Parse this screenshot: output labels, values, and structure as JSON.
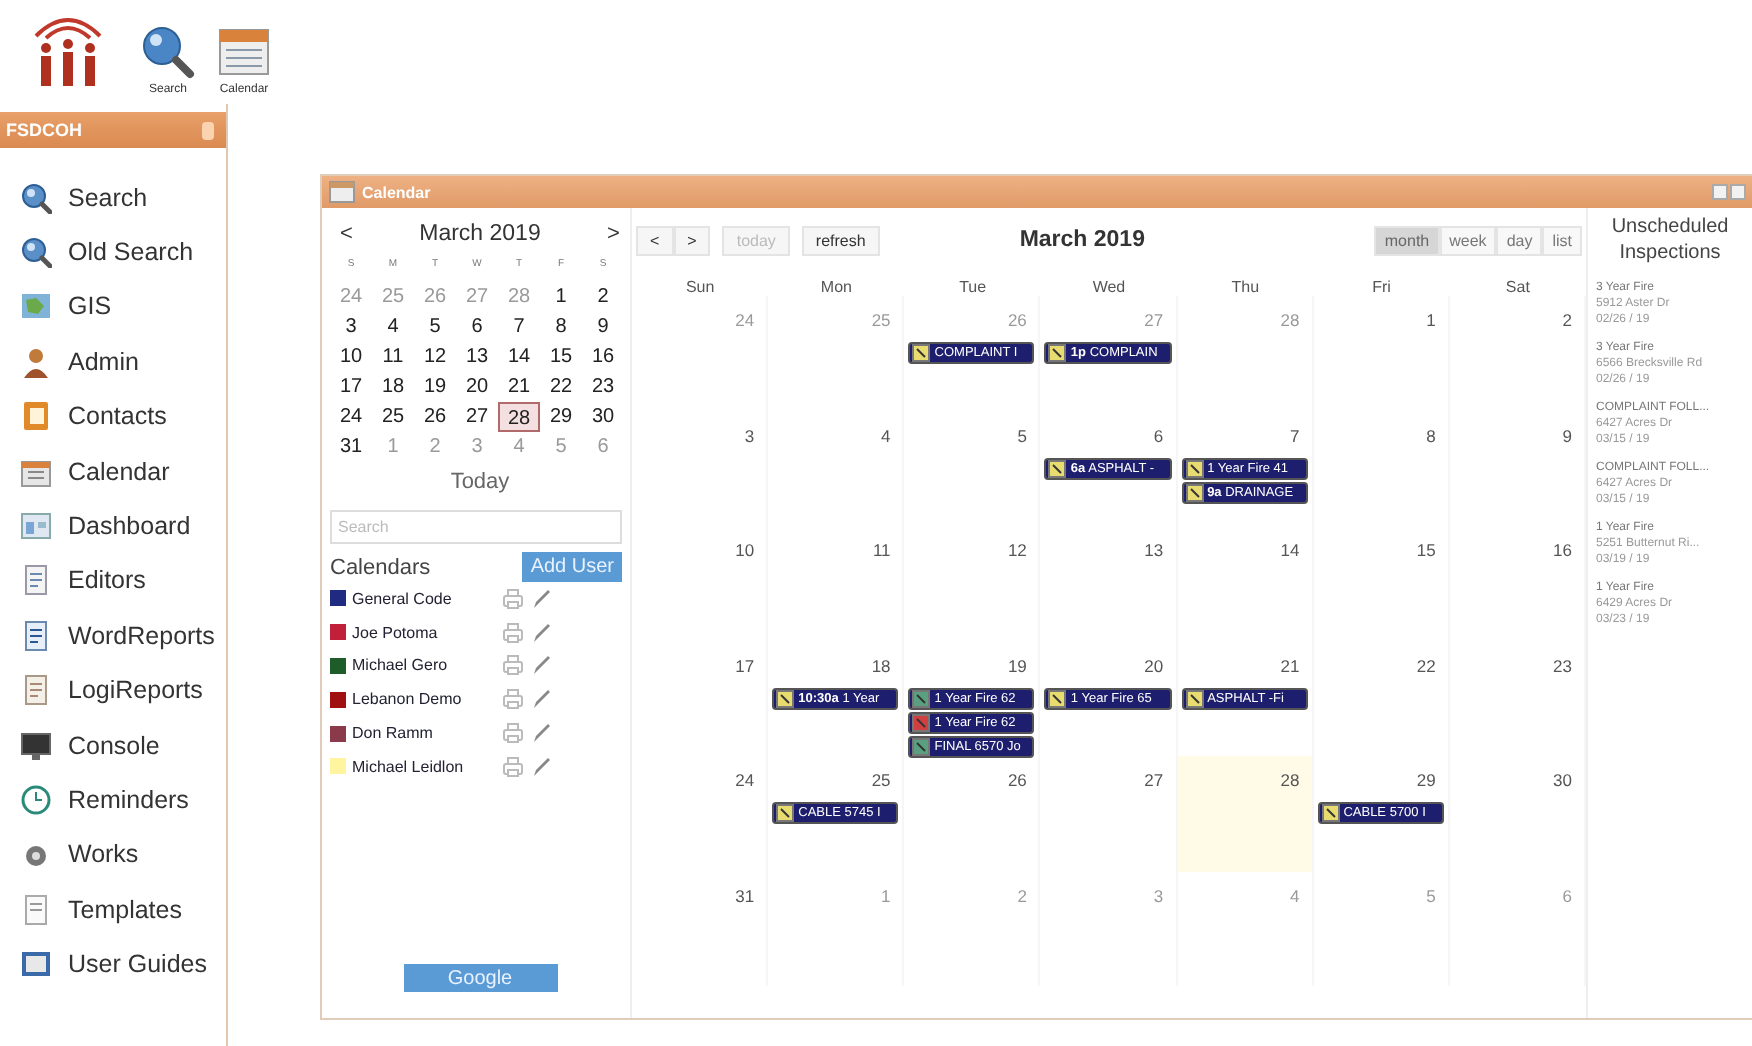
{
  "toolbar": [
    {
      "label": "Search"
    },
    {
      "label": "Calendar"
    }
  ],
  "sidebar": {
    "title": "FSDCOH",
    "items": [
      {
        "label": "Search"
      },
      {
        "label": "Old Search"
      },
      {
        "label": "GIS"
      },
      {
        "label": "Admin"
      },
      {
        "label": "Contacts"
      },
      {
        "label": "Calendar"
      },
      {
        "label": "Dashboard"
      },
      {
        "label": "Editors"
      },
      {
        "label": "WordReports"
      },
      {
        "label": "LogiReports"
      },
      {
        "label": "Console"
      },
      {
        "label": "Reminders"
      },
      {
        "label": "Works"
      },
      {
        "label": "Templates"
      },
      {
        "label": "User Guides"
      }
    ]
  },
  "window": {
    "title": "Calendar"
  },
  "mini_calendar": {
    "prev": "<",
    "title": "March 2019",
    "next": ">",
    "weekdays": [
      "S",
      "M",
      "T",
      "W",
      "T",
      "F",
      "S"
    ],
    "weeks": [
      [
        {
          "day": "24",
          "other_month": true,
          "selected": false
        },
        {
          "day": "25",
          "other_month": true,
          "selected": false
        },
        {
          "day": "26",
          "other_month": true,
          "selected": false
        },
        {
          "day": "27",
          "other_month": true,
          "selected": false
        },
        {
          "day": "28",
          "other_month": true,
          "selected": false
        },
        {
          "day": "1",
          "other_month": false,
          "selected": false
        },
        {
          "day": "2",
          "other_month": false,
          "selected": false
        }
      ],
      [
        {
          "day": "3",
          "other_month": false,
          "selected": false
        },
        {
          "day": "4",
          "other_month": false,
          "selected": false
        },
        {
          "day": "5",
          "other_month": false,
          "selected": false
        },
        {
          "day": "6",
          "other_month": false,
          "selected": false
        },
        {
          "day": "7",
          "other_month": false,
          "selected": false
        },
        {
          "day": "8",
          "other_month": false,
          "selected": false
        },
        {
          "day": "9",
          "other_month": false,
          "selected": false
        }
      ],
      [
        {
          "day": "10",
          "other_month": false,
          "selected": false
        },
        {
          "day": "11",
          "other_month": false,
          "selected": false
        },
        {
          "day": "12",
          "other_month": false,
          "selected": false
        },
        {
          "day": "13",
          "other_month": false,
          "selected": false
        },
        {
          "day": "14",
          "other_month": false,
          "selected": false
        },
        {
          "day": "15",
          "other_month": false,
          "selected": false
        },
        {
          "day": "16",
          "other_month": false,
          "selected": false
        }
      ],
      [
        {
          "day": "17",
          "other_month": false,
          "selected": false
        },
        {
          "day": "18",
          "other_month": false,
          "selected": false
        },
        {
          "day": "19",
          "other_month": false,
          "selected": false
        },
        {
          "day": "20",
          "other_month": false,
          "selected": false
        },
        {
          "day": "21",
          "other_month": false,
          "selected": false
        },
        {
          "day": "22",
          "other_month": false,
          "selected": false
        },
        {
          "day": "23",
          "other_month": false,
          "selected": false
        }
      ],
      [
        {
          "day": "24",
          "other_month": false,
          "selected": false
        },
        {
          "day": "25",
          "other_month": false,
          "selected": false
        },
        {
          "day": "26",
          "other_month": false,
          "selected": false
        },
        {
          "day": "27",
          "other_month": false,
          "selected": false
        },
        {
          "day": "28",
          "other_month": false,
          "selected": true
        },
        {
          "day": "29",
          "other_month": false,
          "selected": false
        },
        {
          "day": "30",
          "other_month": false,
          "selected": false
        }
      ],
      [
        {
          "day": "31",
          "other_month": false,
          "selected": false
        },
        {
          "day": "1",
          "other_month": true,
          "selected": false
        },
        {
          "day": "2",
          "other_month": true,
          "selected": false
        },
        {
          "day": "3",
          "other_month": true,
          "selected": false
        },
        {
          "day": "4",
          "other_month": true,
          "selected": false
        },
        {
          "day": "5",
          "other_month": true,
          "selected": false
        },
        {
          "day": "6",
          "other_month": true,
          "selected": false
        }
      ]
    ]
  },
  "today_button": "Today",
  "search": {
    "placeholder": "Search"
  },
  "calendars": {
    "title": "Calendars",
    "add_button": "Add User",
    "items": [
      {
        "name": "General Code",
        "color": "#1f2a80"
      },
      {
        "name": "Joe Potoma",
        "color": "#c0203a"
      },
      {
        "name": "Michael Gero",
        "color": "#1e5c2a"
      },
      {
        "name": "Lebanon Demo",
        "color": "#a01010"
      },
      {
        "name": "Don Ramm",
        "color": "#8a3a4a"
      },
      {
        "name": "Michael Leidlon",
        "color": "#fff4a0"
      }
    ]
  },
  "google_button": "Google",
  "calendar": {
    "prev": "<",
    "next": ">",
    "today_button": {
      "label": "today",
      "disabled": true
    },
    "refresh_button": "refresh",
    "title": "March 2019",
    "views": [
      {
        "label": "month",
        "selected": true
      },
      {
        "label": "week",
        "selected": false
      },
      {
        "label": "day",
        "selected": false
      },
      {
        "label": "list",
        "selected": false
      }
    ],
    "weekdays": [
      "Sun",
      "Mon",
      "Tue",
      "Wed",
      "Thu",
      "Fri",
      "Sat"
    ],
    "weeks": [
      [
        {
          "day": "24",
          "other_month": true,
          "today": false
        },
        {
          "day": "25",
          "other_month": true,
          "today": false
        },
        {
          "day": "26",
          "other_month": true,
          "today": false,
          "events": [
            {
              "title": "COMPLAINT I",
              "color": "#e8dc70"
            }
          ]
        },
        {
          "day": "27",
          "other_month": true,
          "today": false,
          "events": [
            {
              "title": "**1p** COMPLAIN",
              "color": "#e8dc70"
            }
          ]
        },
        {
          "day": "28",
          "other_month": true,
          "today": false
        },
        {
          "day": "1",
          "other_month": false,
          "today": false
        },
        {
          "day": "2",
          "other_month": false,
          "today": false
        }
      ],
      [
        {
          "day": "3",
          "other_month": false,
          "today": false
        },
        {
          "day": "4",
          "other_month": false,
          "today": false
        },
        {
          "day": "5",
          "other_month": false,
          "today": false
        },
        {
          "day": "6",
          "other_month": false,
          "today": false,
          "events": [
            {
              "title": "**6a** ASPHALT -",
              "color": "#e8dc70"
            }
          ]
        },
        {
          "day": "7",
          "other_month": false,
          "today": false,
          "events": [
            {
              "title": "1 Year Fire 41",
              "color": "#e8dc70"
            },
            {
              "title": "**9a** DRAINAGE",
              "color": "#e8dc70"
            }
          ]
        },
        {
          "day": "8",
          "other_month": false,
          "today": false
        },
        {
          "day": "9",
          "other_month": false,
          "today": false
        }
      ],
      [
        {
          "day": "10",
          "other_month": false,
          "today": false
        },
        {
          "day": "11",
          "other_month": false,
          "today": false
        },
        {
          "day": "12",
          "other_month": false,
          "today": false
        },
        {
          "day": "13",
          "other_month": false,
          "today": false
        },
        {
          "day": "14",
          "other_month": false,
          "today": false
        },
        {
          "day": "15",
          "other_month": false,
          "today": false
        },
        {
          "day": "16",
          "other_month": false,
          "today": false
        }
      ],
      [
        {
          "day": "17",
          "other_month": false,
          "today": false
        },
        {
          "day": "18",
          "other_month": false,
          "today": false,
          "events": [
            {
              "title": "**10:30a** 1 Year",
              "color": "#e8dc70"
            }
          ]
        },
        {
          "day": "19",
          "other_month": false,
          "today": false,
          "events": [
            {
              "title": "1 Year Fire 62",
              "color": "#5aa080"
            },
            {
              "title": "1 Year Fire 62",
              "color": "#d04040"
            },
            {
              "title": "FINAL 6570 Jo",
              "color": "#5aa080"
            }
          ]
        },
        {
          "day": "20",
          "other_month": false,
          "today": false,
          "events": [
            {
              "title": "1 Year Fire 65",
              "color": "#e8dc70"
            }
          ]
        },
        {
          "day": "21",
          "other_month": false,
          "today": false,
          "events": [
            {
              "title": "ASPHALT -Fi",
              "color": "#e8dc70"
            }
          ]
        },
        {
          "day": "22",
          "other_month": false,
          "today": false
        },
        {
          "day": "23",
          "other_month": false,
          "today": false
        }
      ],
      [
        {
          "day": "24",
          "other_month": false,
          "today": false
        },
        {
          "day": "25",
          "other_month": false,
          "today": false,
          "events": [
            {
              "title": "CABLE 5745 I",
              "color": "#e8dc70"
            }
          ]
        },
        {
          "day": "26",
          "other_month": false,
          "today": false
        },
        {
          "day": "27",
          "other_month": false,
          "today": false
        },
        {
          "day": "28",
          "other_month": false,
          "today": true
        },
        {
          "day": "29",
          "other_month": false,
          "today": false,
          "events": [
            {
              "title": "CABLE 5700 I",
              "color": "#e8dc70"
            }
          ]
        },
        {
          "day": "30",
          "other_month": false,
          "today": false
        }
      ],
      [
        {
          "day": "31",
          "other_month": false,
          "today": false
        },
        {
          "day": "1",
          "other_month": true,
          "today": false
        },
        {
          "day": "2",
          "other_month": true,
          "today": false
        },
        {
          "day": "3",
          "other_month": true,
          "today": false
        },
        {
          "day": "4",
          "other_month": true,
          "today": false
        },
        {
          "day": "5",
          "other_month": true,
          "today": false
        },
        {
          "day": "6",
          "other_month": true,
          "today": false
        }
      ]
    ]
  },
  "unscheduled": {
    "title": "Unscheduled Inspections",
    "items": [
      {
        "type": "3 Year Fire",
        "address": "5912 Aster Dr",
        "date": "02/26 / 19"
      },
      {
        "type": "3 Year Fire",
        "address": "6566 Brecksville Rd",
        "date": "02/26 / 19"
      },
      {
        "type": "COMPLAINT FOLL...",
        "address": "6427 Acres Dr",
        "date": "03/15 / 19"
      },
      {
        "type": "COMPLAINT FOLL...",
        "address": "6427 Acres Dr",
        "date": "03/15 / 19"
      },
      {
        "type": "1 Year Fire",
        "address": "5251 Butternut Ri...",
        "date": "03/19 / 19"
      },
      {
        "type": "1 Year Fire",
        "address": "6429 Acres Dr",
        "date": "03/23 / 19"
      }
    ]
  }
}
